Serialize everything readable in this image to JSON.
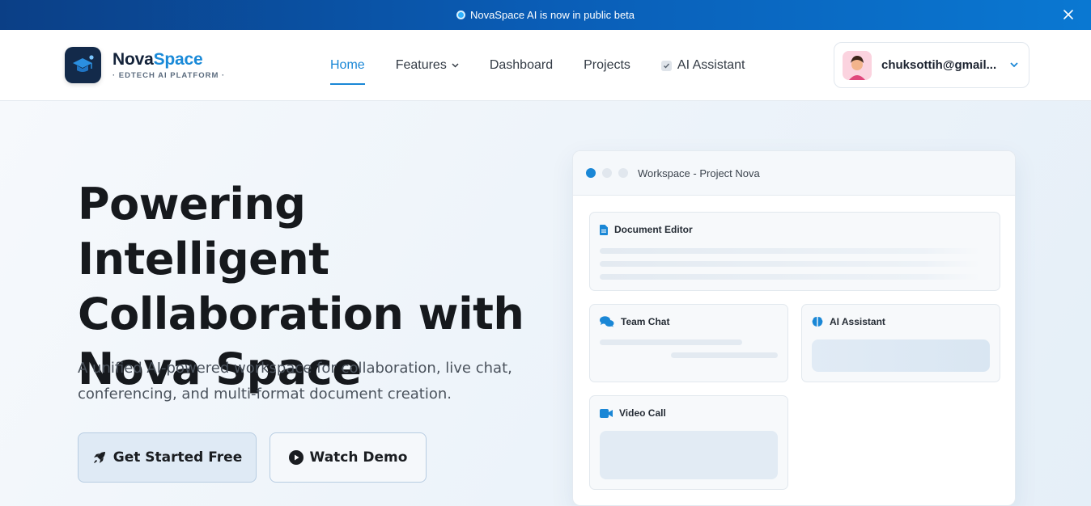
{
  "banner": {
    "text": "NovaSpace AI is now in public beta"
  },
  "brand": {
    "name_part1": "Nova",
    "name_part2": "Space",
    "tagline": "· EDTECH AI PLATFORM ·"
  },
  "nav": {
    "items": [
      {
        "label": "Home",
        "active": true
      },
      {
        "label": "Features",
        "has_dropdown": true
      },
      {
        "label": "Dashboard"
      },
      {
        "label": "Projects"
      },
      {
        "label": "AI Assistant",
        "icon": "ai-badge-icon"
      }
    ]
  },
  "user": {
    "email": "chuksottih@gmail..."
  },
  "hero": {
    "title": "Powering Intelligent Collaboration with Nova Space",
    "subtitle": "A unified AI-powered workspace for collaboration, live chat, conferencing, and multi-format document creation.",
    "primary_button": "Get Started Free",
    "secondary_button": "Watch Demo"
  },
  "workspace": {
    "title": "Workspace - Project Nova",
    "panels": {
      "doc": "Document Editor",
      "chat": "Team Chat",
      "ai": "AI Assistant",
      "video": "Video Call"
    }
  },
  "colors": {
    "accent": "#1a87d6",
    "banner_start": "#0b3f86",
    "banner_end": "#0a78d2",
    "logo_bg": "#132a4a"
  }
}
